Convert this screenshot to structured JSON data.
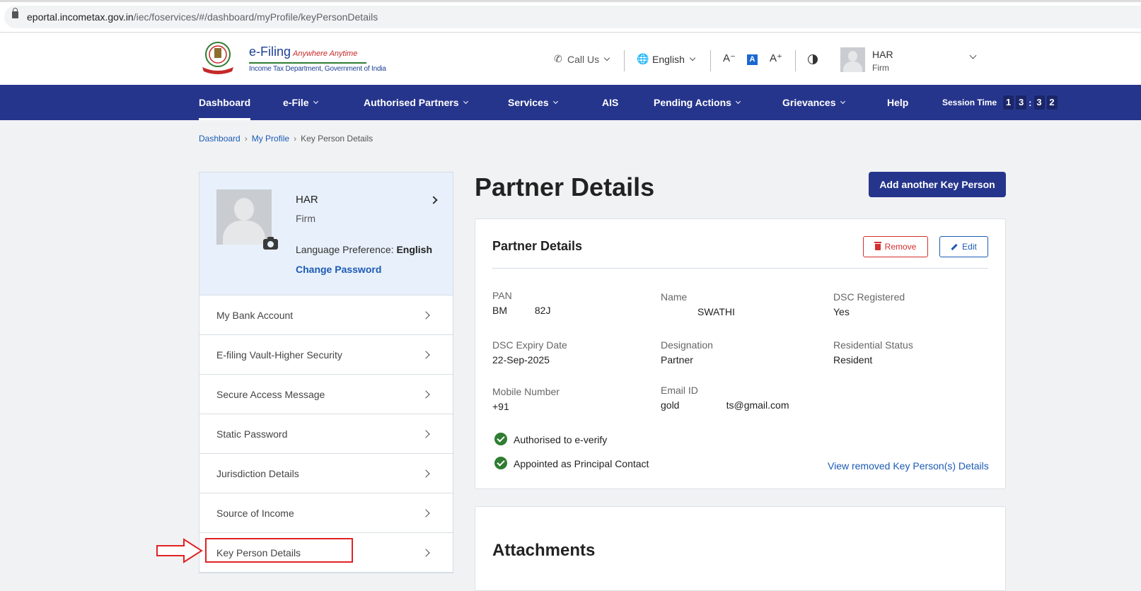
{
  "browser": {
    "url_host": "eportal.incometax.gov.in",
    "url_path": "/iec/foservices/#/dashboard/myProfile/keyPersonDetails"
  },
  "header": {
    "logo_brand": "e-Filing",
    "logo_tagline": "Anywhere Anytime",
    "logo_dept": "Income Tax Department, Government of India",
    "call_us": "Call Us",
    "language": "English",
    "font_decrease": "A⁻",
    "font_default": "A",
    "font_increase": "A⁺",
    "user_name": "HAR",
    "user_type": "Firm"
  },
  "nav": {
    "items": [
      {
        "label": "Dashboard"
      },
      {
        "label": "e-File"
      },
      {
        "label": "Authorised Partners"
      },
      {
        "label": "Services"
      },
      {
        "label": "AIS"
      },
      {
        "label": "Pending Actions"
      },
      {
        "label": "Grievances"
      },
      {
        "label": "Help"
      }
    ],
    "session_label": "Session Time",
    "session_digits": [
      "1",
      "3",
      ":",
      "3",
      "2"
    ]
  },
  "breadcrumb": {
    "items": [
      "Dashboard",
      "My Profile",
      "Key Person Details"
    ]
  },
  "profile": {
    "name": "HAR",
    "type": "Firm",
    "language_label": "Language Preference:",
    "language_value": "English",
    "change_password": "Change Password"
  },
  "menu": {
    "items": [
      {
        "label": "My Bank Account"
      },
      {
        "label": "E-filing Vault-Higher Security"
      },
      {
        "label": "Secure Access Message"
      },
      {
        "label": "Static Password"
      },
      {
        "label": "Jurisdiction Details"
      },
      {
        "label": "Source of Income"
      },
      {
        "label": "Key Person Details"
      }
    ]
  },
  "main": {
    "title": "Partner Details",
    "add_button": "Add another Key Person",
    "card": {
      "title": "Partner Details",
      "remove": "Remove",
      "edit": "Edit",
      "fields": {
        "pan_label": "PAN",
        "pan_value": "BM          82J",
        "name_label": "Name",
        "name_value": "SWATHI",
        "dsc_reg_label": "DSC Registered",
        "dsc_reg_value": "Yes",
        "dsc_exp_label": "DSC Expiry Date",
        "dsc_exp_value": "22-Sep-2025",
        "designation_label": "Designation",
        "designation_value": "Partner",
        "residential_label": "Residential Status",
        "residential_value": "Resident",
        "mobile_label": "Mobile Number",
        "mobile_value": "+91",
        "email_label": "Email ID",
        "email_value": "gold                 ts@gmail.com"
      },
      "check1": "Authorised to e-verify",
      "check2": "Appointed as Principal Contact",
      "view_removed": "View removed Key Person(s) Details"
    },
    "attachments_title": "Attachments"
  },
  "colors": {
    "nav_bg": "#26358c",
    "link": "#1c5bb5",
    "remove": "#d32f2f",
    "check": "#2e7d32",
    "highlight": "#e02424"
  }
}
